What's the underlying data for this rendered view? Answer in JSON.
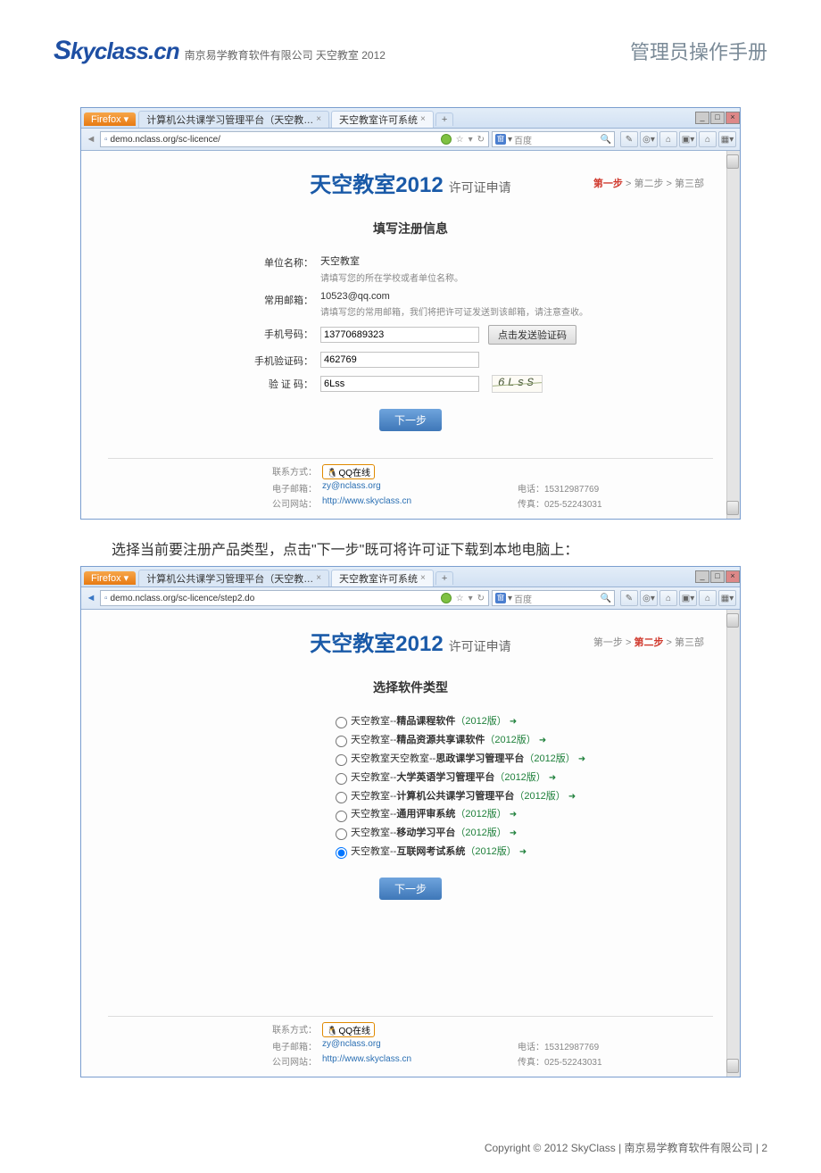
{
  "doc_header": {
    "logo": "Skyclass.cn",
    "logo_sub": "南京易学教育软件有限公司 天空教室 2012",
    "right": "管理员操作手册"
  },
  "shot1": {
    "firefox_btn": "Firefox ▾",
    "tab1": "计算机公共课学习管理平台（天空教…",
    "tab2": "天空教室许可系统",
    "url": "demo.nclass.org/sc-licence/",
    "search_placeholder": "百度",
    "title_main": "天空教室2012",
    "title_sub": "许可证申请",
    "steps": {
      "s1": "第一步",
      "s2": "第二步",
      "s3": "第三部",
      "active": 1
    },
    "section": "填写注册信息",
    "fields": {
      "unit_label": "单位名称：",
      "unit_value": "天空教室",
      "unit_hint": "请填写您的所在学校或者单位名称。",
      "email_label": "常用邮箱：",
      "email_value": "10523@qq.com",
      "email_hint": "请填写您的常用邮箱，我们将把许可证发送到该邮箱，请注意查收。",
      "phone_label": "手机号码：",
      "phone_value": "13770689323",
      "send_code_btn": "点击发送验证码",
      "smscode_label": "手机验证码：",
      "smscode_value": "462769",
      "captcha_label": "验 证 码：",
      "captcha_value": "6Lss",
      "captcha_img": "6LsS"
    },
    "next_btn": "下一步",
    "footer": {
      "contact_lbl": "联系方式：",
      "qq": "QQ在线",
      "email_lbl": "电子邮箱：",
      "email_val": "zy@nclass.org",
      "site_lbl": "公司网站：",
      "site_val": "http://www.skyclass.cn",
      "phone_lbl": "电话：",
      "phone_val": "15312987769",
      "fax_lbl": "传真：",
      "fax_val": "025-52243031"
    }
  },
  "mid_text": "选择当前要注册产品类型，点击\"下一步\"既可将许可证下载到本地电脑上：",
  "shot2": {
    "firefox_btn": "Firefox ▾",
    "tab1": "计算机公共课学习管理平台（天空教…",
    "tab2": "天空教室许可系统",
    "url": "demo.nclass.org/sc-licence/step2.do",
    "search_placeholder": "百度",
    "title_main": "天空教室2012",
    "title_sub": "许可证申请",
    "steps": {
      "s1": "第一步",
      "s2": "第二步",
      "s3": "第三部",
      "active": 2
    },
    "section": "选择软件类型",
    "options": [
      {
        "pre": "天空教室--",
        "b": "精品课程软件",
        "year": "（2012版）",
        "checked": false
      },
      {
        "pre": "天空教室--",
        "b": "精品资源共享课软件",
        "year": "（2012版）",
        "checked": false
      },
      {
        "pre": "天空教室天空教室--",
        "b": "思政课学习管理平台",
        "year": "（2012版）",
        "checked": false
      },
      {
        "pre": "天空教室--",
        "b": "大学英语学习管理平台",
        "year": "（2012版）",
        "checked": false
      },
      {
        "pre": "天空教室--",
        "b": "计算机公共课学习管理平台",
        "year": "（2012版）",
        "checked": false
      },
      {
        "pre": "天空教室--",
        "b": "通用评审系统",
        "year": "（2012版）",
        "checked": false
      },
      {
        "pre": "天空教室--",
        "b": "移动学习平台",
        "year": "（2012版）",
        "checked": false
      },
      {
        "pre": "天空教室--",
        "b": "互联网考试系统",
        "year": "（2012版）",
        "checked": true
      }
    ],
    "next_btn": "下一步"
  },
  "page_footer": "Copyright © 2012 SkyClass  | 南京易学教育软件有限公司 | 2"
}
